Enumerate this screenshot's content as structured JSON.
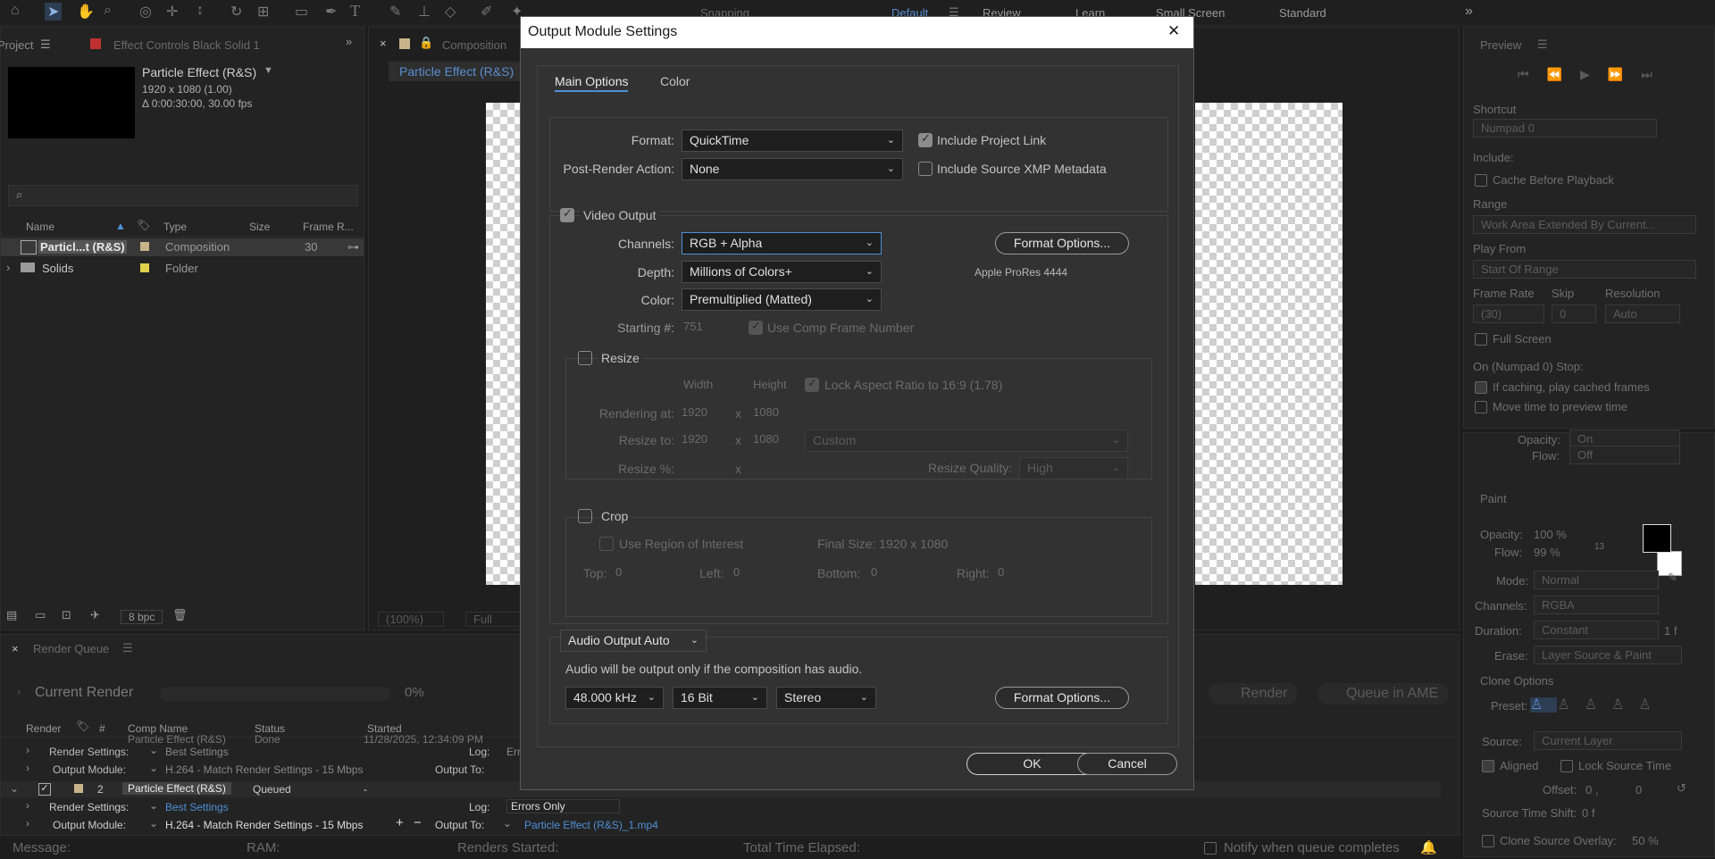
{
  "topbar": {
    "workspaces": [
      "Default",
      "Review",
      "Learn",
      "Small Screen",
      "Standard"
    ],
    "snapping": "Snapping",
    "more_label": "»"
  },
  "project": {
    "tab": "Project",
    "effect_controls_tab": "Effect Controls Black Solid 1",
    "comp_name": "Particle Effect (R&S)",
    "comp_size": "1920 x 1080 (1.00)",
    "comp_duration": "Δ 0:00:30:00, 30.00 fps",
    "columns": [
      "Name",
      "Type",
      "Size",
      "Frame R..."
    ],
    "items": [
      {
        "name": "Particl...t (R&S)",
        "type": "Composition",
        "size": "",
        "fps": "30"
      },
      {
        "name": "Solids",
        "type": "Folder",
        "size": "",
        "fps": ""
      }
    ],
    "bpc": "8 bpc"
  },
  "composition": {
    "tab": "Composition",
    "comp_tab": "Particle Effect (R&S)",
    "zoom": "(100%)",
    "resolution": "Full"
  },
  "render_queue": {
    "tab": "Render Queue",
    "current_render": "Current Render",
    "progress": "0%",
    "render_btn": "Render",
    "queue_ame_btn": "Queue in AME",
    "columns": [
      "Render",
      "#",
      "Comp Name",
      "Status",
      "Started"
    ],
    "first_item": {
      "comp": "Particle Effect (R&S)",
      "status": "Done",
      "started": "11/28/2025, 12:34:09 PM",
      "render_settings": "Best Settings",
      "output_module": "H.264 - Match Render Settings - 15 Mbps",
      "log": "Errors Only"
    },
    "second_item": {
      "num": "2",
      "comp": "Particle Effect (R&S)",
      "status": "Queued",
      "started": "-",
      "render_settings": "Best Settings",
      "output_module": "H.264 - Match Render Settings - 15 Mbps",
      "log": "Errors Only",
      "output_to": "Particle Effect (R&S)_1.mp4"
    },
    "labels": {
      "render_settings": "Render Settings:",
      "output_module": "Output Module:",
      "log": "Log:",
      "output_to": "Output To:"
    },
    "status_bar": {
      "message": "Message:",
      "ram": "RAM:",
      "renders_started": "Renders Started:",
      "total_elapsed": "Total Time Elapsed:",
      "notify": "Notify when queue completes"
    }
  },
  "preview": {
    "title": "Preview",
    "shortcut_label": "Shortcut",
    "shortcut_value": "Numpad 0",
    "include": "Include:",
    "cache_before_playback": "Cache Before Playback",
    "range_label": "Range",
    "range_value": "Work Area Extended By Current...",
    "play_from_label": "Play From",
    "play_from_value": "Start Of Range",
    "frame_rate_label": "Frame Rate",
    "skip_label": "Skip",
    "resolution_label": "Resolution",
    "frame_rate_value": "(30)",
    "skip_value": "0",
    "resolution_value": "Auto",
    "full_screen": "Full Screen",
    "stop_label": "On (Numpad 0) Stop:",
    "if_caching": "If caching, play cached frames",
    "move_time": "Move time to preview time"
  },
  "paint": {
    "opacity_top_label": "Opacity:",
    "opacity_top_value": "On",
    "flow_top_label": "Flow:",
    "flow_top_value": "Off",
    "title": "Paint",
    "opacity": "Opacity:",
    "opacity_value": "100 %",
    "flow": "Flow:",
    "flow_value": "99 %",
    "brush_size": "13",
    "mode_label": "Mode:",
    "mode_value": "Normal",
    "channels_label": "Channels:",
    "channels_value": "RGBA",
    "duration_label": "Duration:",
    "duration_value": "Constant",
    "duration_frames": "1 f",
    "erase_label": "Erase:",
    "erase_value": "Layer Source & Paint",
    "clone_options": "Clone Options",
    "preset_label": "Preset:",
    "source_label": "Source:",
    "source_value": "Current Layer",
    "aligned": "Aligned",
    "lock_source_time": "Lock Source Time",
    "offset_label": "Offset:",
    "offset_x": "0 ,",
    "offset_y": "0",
    "source_time_shift": "Source Time Shift:",
    "source_time_shift_value": "0 f",
    "clone_overlay": "Clone Source Overlay:",
    "clone_overlay_value": "50 %"
  },
  "dialog": {
    "title": "Output Module Settings",
    "close_icon": "✕",
    "tabs": [
      "Main Options",
      "Color"
    ],
    "format_label": "Format:",
    "format_value": "QuickTime",
    "post_render_label": "Post-Render Action:",
    "post_render_value": "None",
    "include_project_link": "Include Project Link",
    "include_xmp": "Include Source XMP Metadata",
    "video_output": "Video Output",
    "channels_label": "Channels:",
    "channels_value": "RGB + Alpha",
    "depth_label": "Depth:",
    "depth_value": "Millions of Colors+",
    "color_label": "Color:",
    "color_value": "Premultiplied (Matted)",
    "starting_label": "Starting #:",
    "starting_value": "751",
    "use_comp_frame": "Use Comp Frame Number",
    "format_options": "Format Options...",
    "codec": "Apple ProRes 4444",
    "resize": "Resize",
    "width_hdr": "Width",
    "height_hdr": "Height",
    "lock_aspect": "Lock Aspect Ratio to 16:9 (1.78)",
    "rendering_at": "Rendering at:",
    "rendering_w": "1920",
    "rendering_h": "1080",
    "resize_to": "Resize to:",
    "resize_w": "1920",
    "resize_h": "1080",
    "resize_preset": "Custom",
    "resize_pct": "Resize %:",
    "x": "x",
    "resize_quality_label": "Resize Quality:",
    "resize_quality_value": "High",
    "crop": "Crop",
    "use_roi": "Use Region of Interest",
    "final_size": "Final Size: 1920 x 1080",
    "top_label": "Top:",
    "top_value": "0",
    "left_label": "Left:",
    "left_value": "0",
    "bottom_label": "Bottom:",
    "bottom_value": "0",
    "right_label": "Right:",
    "right_value": "0",
    "audio_output": "Audio Output Auto",
    "audio_note": "Audio will be output only if the composition has audio.",
    "sample_rate": "48.000 kHz",
    "bit_depth": "16 Bit",
    "channels_audio": "Stereo",
    "audio_format_options": "Format Options...",
    "ok": "OK",
    "cancel": "Cancel"
  }
}
